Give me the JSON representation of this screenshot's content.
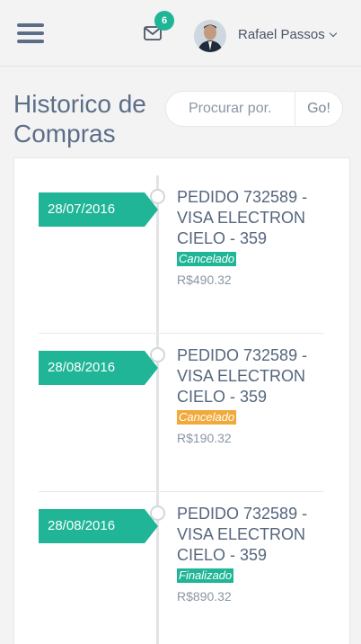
{
  "header": {
    "notification_count": "6",
    "user_name": "Rafael Passos"
  },
  "page": {
    "title": "Historico de Compras"
  },
  "search": {
    "placeholder": "Procurar por.",
    "button_label": "Go!"
  },
  "orders": [
    {
      "date": "28/07/2016",
      "title": "PEDIDO 732589 - VISA ELECTRON CIELO - 359",
      "status": "Cancelado",
      "status_color": "#1fb596",
      "price": "R$490.32"
    },
    {
      "date": "28/08/2016",
      "title": "PEDIDO 732589 - VISA ELECTRON CIELO - 359",
      "status": "Cancelado",
      "status_color": "#f2a93b",
      "price": "R$190.32"
    },
    {
      "date": "28/08/2016",
      "title": "PEDIDO 732589 - VISA ELECTRON CIELO - 359",
      "status": "Finalizado",
      "status_color": "#1fb596",
      "price": "R$890.32"
    }
  ],
  "icons": {
    "menu": "hamburger-menu-icon",
    "mail": "envelope-icon",
    "dropdown": "chevron-down-icon",
    "timeline_node": "circle-icon"
  }
}
